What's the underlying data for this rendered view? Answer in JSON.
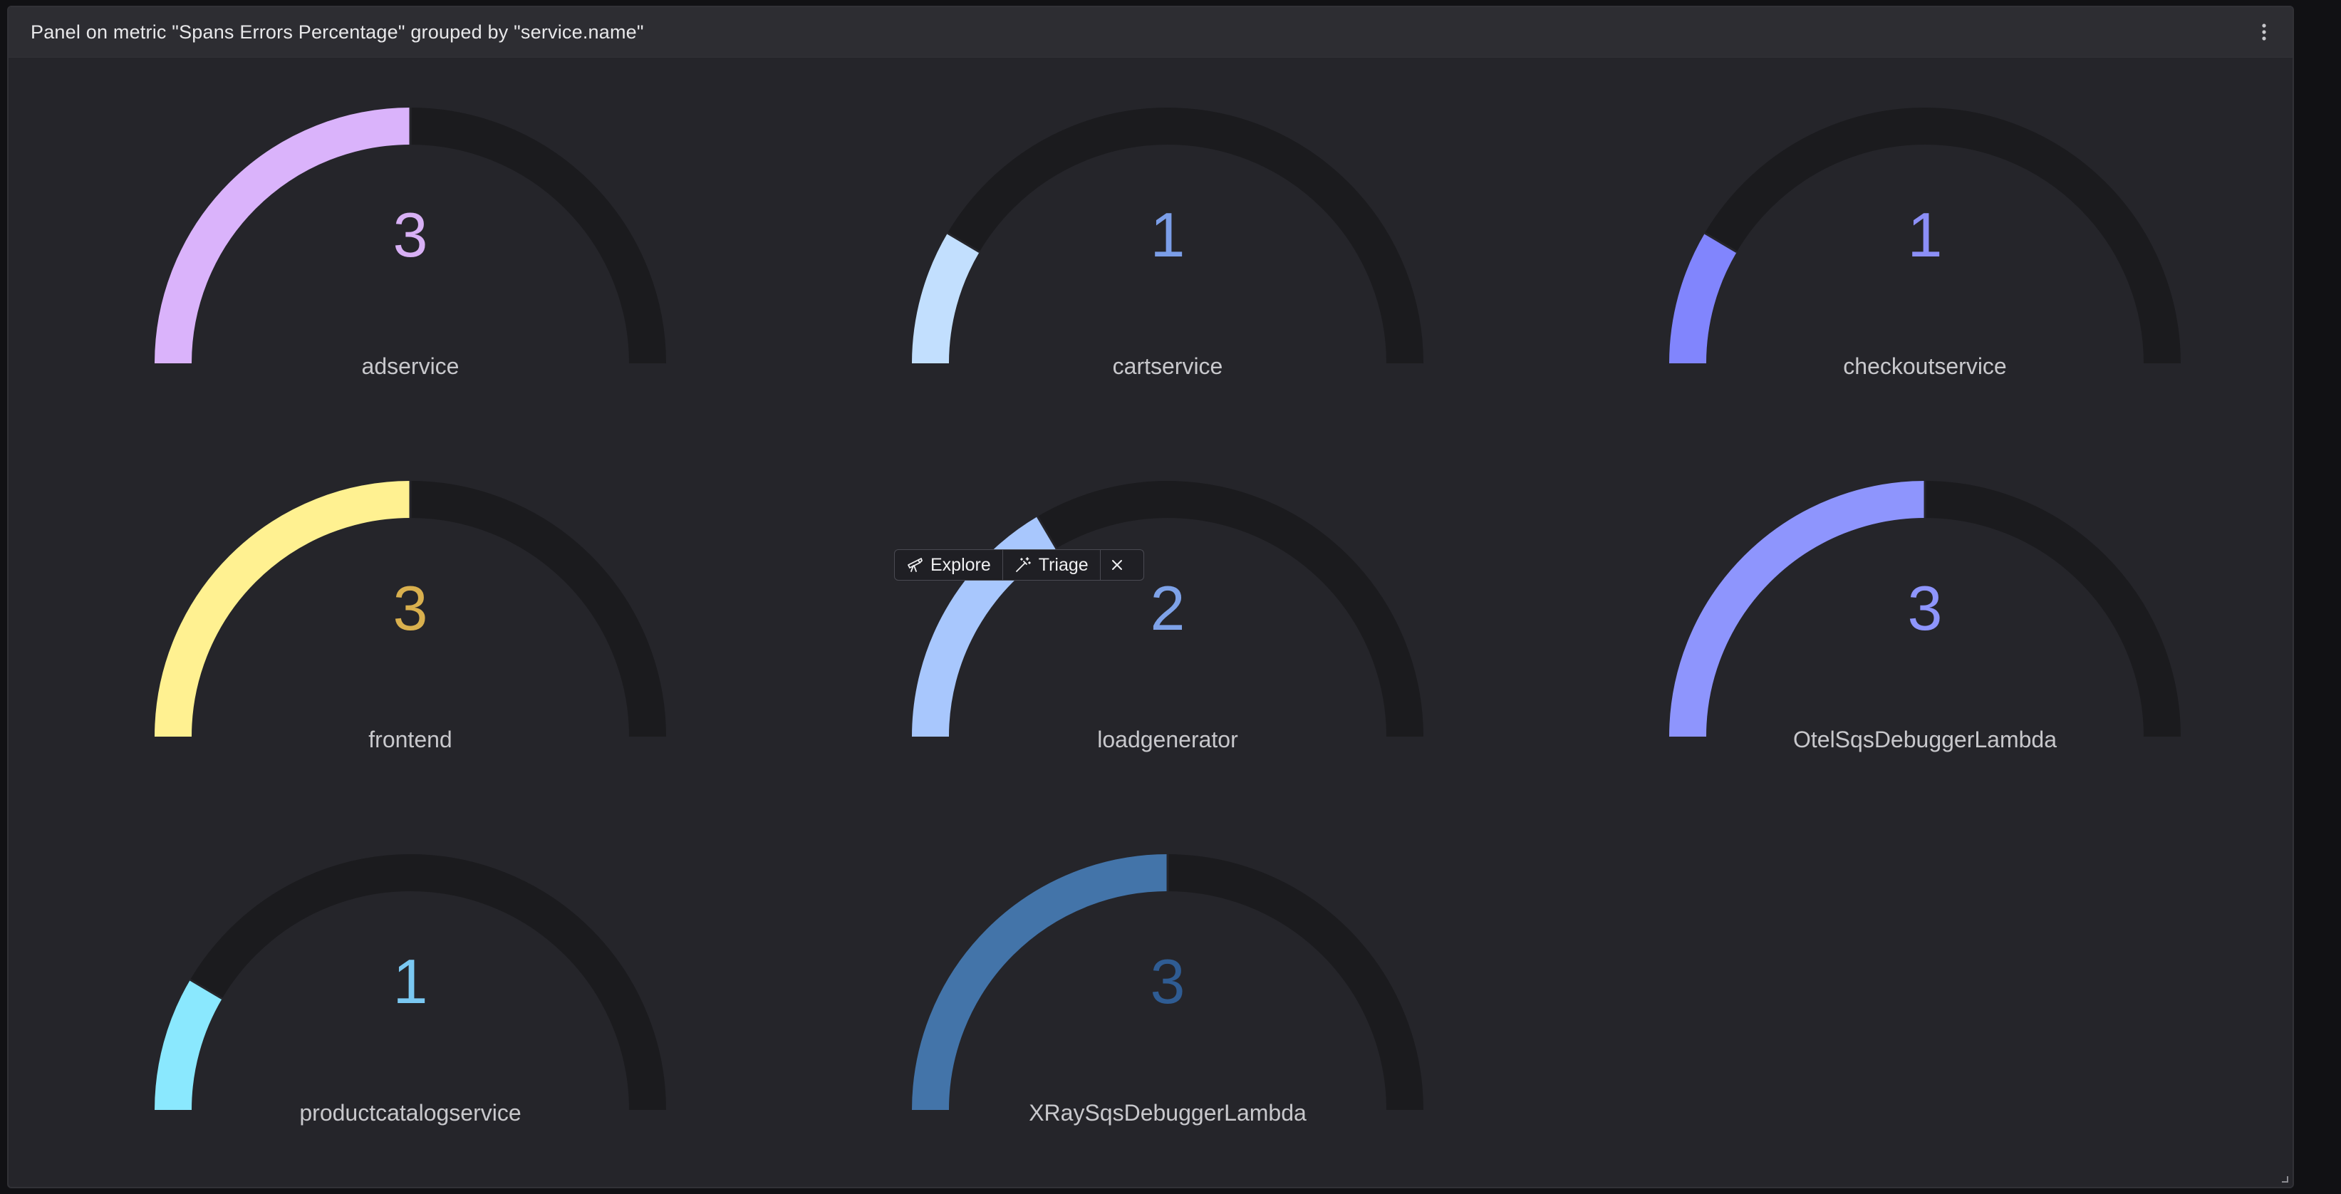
{
  "panel": {
    "title": "Panel on metric \"Spans Errors Percentage\" grouped by \"service.name\""
  },
  "action_bar": {
    "explore_label": "Explore",
    "triage_label": "Triage"
  },
  "gauges": [
    {
      "name": "adservice",
      "value": "3",
      "fraction": 0.5,
      "fill_color": "#dab3fb",
      "text_color": "#d8b0f5"
    },
    {
      "name": "cartservice",
      "value": "1",
      "fraction": 0.17,
      "fill_color": "#c2dffe",
      "text_color": "#7b9ee8"
    },
    {
      "name": "checkoutservice",
      "value": "1",
      "fraction": 0.17,
      "fill_color": "#8185fd",
      "text_color": "#8c8ff7"
    },
    {
      "name": "frontend",
      "value": "3",
      "fraction": 0.5,
      "fill_color": "#fff191",
      "text_color": "#d9b04e"
    },
    {
      "name": "loadgenerator",
      "value": "2",
      "fraction": 0.33,
      "fill_color": "#a8c7fd",
      "text_color": "#7ea2e8"
    },
    {
      "name": "OtelSqsDebuggerLambda",
      "value": "3",
      "fraction": 0.5,
      "fill_color": "#8e95fd",
      "text_color": "#8e95fd"
    },
    {
      "name": "productcatalogservice",
      "value": "1",
      "fraction": 0.17,
      "fill_color": "#8ae8fe",
      "text_color": "#7ac8f2"
    },
    {
      "name": "XRaySqsDebuggerLambda",
      "value": "3",
      "fraction": 0.5,
      "fill_color": "#4374a9",
      "text_color": "#2f5c93"
    }
  ],
  "colors": {
    "track": "#1b1b1e",
    "panel_bg": "#25252a",
    "label": "#c8c8cc"
  }
}
